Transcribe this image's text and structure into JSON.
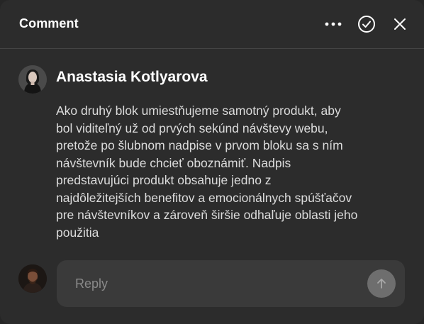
{
  "header": {
    "title": "Comment",
    "actions": [
      {
        "icon": "more-horizontal-icon"
      },
      {
        "icon": "check-circle-icon"
      },
      {
        "icon": "close-icon"
      }
    ]
  },
  "comment": {
    "author": "Anastasia Kotlyarova",
    "lines": [
      "Ako druhý blok umiestňujeme samotný produkt, aby",
      "bol viditeľný už od prvých sekúnd návštevy webu,",
      "pretože po šlubnom nadpise v prvom bloku sa s ním",
      "návštevník bude chcieť oboznámiť. Nadpis",
      "predstavujúci produkt obsahuje jedno z",
      "najdôležitejších benefitov a emocionálnych spúšťačov",
      "pre návštevníkov a zároveň širšie odhaľuje oblasti jeho",
      "použitia"
    ]
  },
  "reply": {
    "placeholder": "Reply",
    "value": "",
    "send_icon": "arrow-up-icon"
  },
  "colors": {
    "panel_bg": "#2c2c2c",
    "input_bg": "#3a3a3a",
    "send_button_bg": "#6e6e6e",
    "text_primary": "#ffffff",
    "text_body": "#dcdcdc",
    "placeholder": "#8a8a8a",
    "divider": "#444444"
  }
}
